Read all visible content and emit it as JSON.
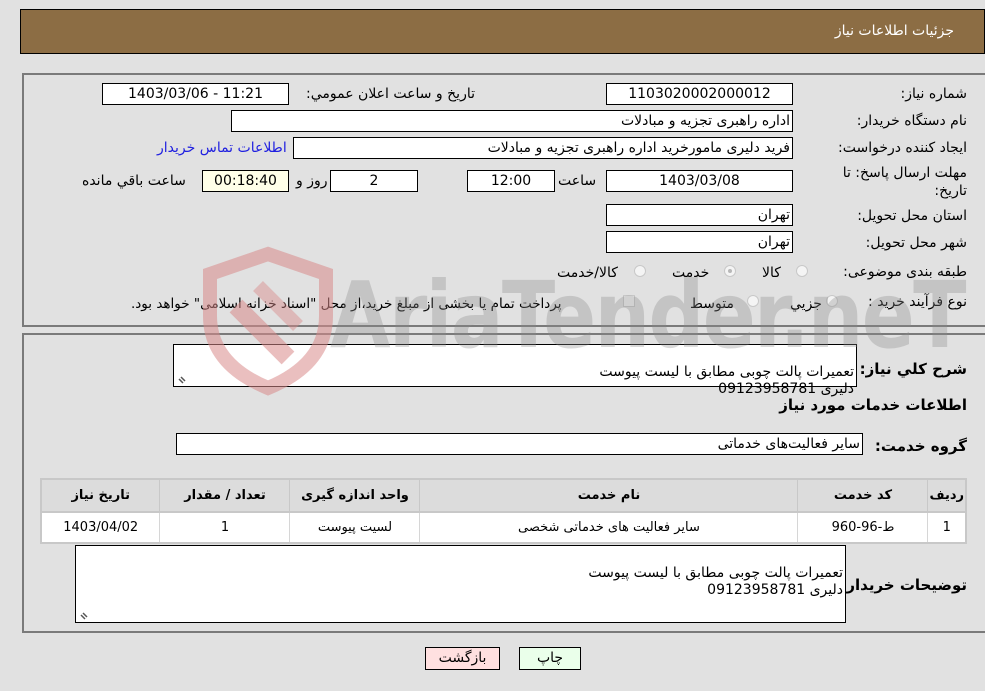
{
  "header": {
    "title": "جزئیات اطلاعات نیاز"
  },
  "form": {
    "need_number_label": "شماره نیاز:",
    "need_number": "1103020002000012",
    "announce_label": "تاریخ و ساعت اعلان عمومي:",
    "announce_value": "1403/03/06 - 11:21",
    "buyer_org_label": "نام دستگاه خريدار:",
    "buyer_org": "اداره راهبری تجزیه و مبادلات",
    "creator_label": "ایجاد کننده درخواست:",
    "creator": "فرید دلیری مامورخرید اداره راهبری تجزیه و مبادلات",
    "contact_link": "اطلاعات تماس خريدار",
    "deadline_label_1": "مهلت ارسال پاسخ: تا",
    "deadline_label_2": "تاريخ:",
    "deadline_date": "1403/03/08",
    "time_label": "ساعت",
    "deadline_time": "12:00",
    "days_value": "2",
    "days_label": "روز و",
    "remaining_time": "00:18:40",
    "remaining_label": "ساعت باقي مانده",
    "province_label": "استان محل تحویل:",
    "province": "تهران",
    "city_label": "شهر محل تحویل:",
    "city": "تهران",
    "category_label": "طبقه بندی موضوعی:",
    "category_options": [
      {
        "label": "کالا",
        "checked": false
      },
      {
        "label": "خدمت",
        "checked": true
      },
      {
        "label": "کالا/خدمت",
        "checked": false
      }
    ],
    "process_label": "نوع فرآیند خرید :",
    "process_options": [
      {
        "label": "جزيي",
        "checked": false
      },
      {
        "label": "متوسط",
        "checked": false
      }
    ],
    "treasury_checkbox_label": "پرداخت تمام یا بخشی از مبلغ خرید،از محل \"اسناد خزانه اسلامی\" خواهد بود.",
    "treasury_checked": false
  },
  "description": {
    "label": "شرح کلي نياز:",
    "value": "تعمیرات پالت چوبی مطابق با لیست پیوست\nدلیری 09123958781"
  },
  "services": {
    "section_title": "اطلاعات خدمات مورد نیاز",
    "group_label": "گروه خدمت:",
    "group_value": "سایر فعالیت‌های خدماتی",
    "columns": [
      "رديف",
      "کد خدمت",
      "نام خدمت",
      "واحد اندازه گیری",
      "تعداد / مقدار",
      "تاريخ نياز"
    ],
    "rows": [
      {
        "row": "1",
        "code": "ط-96-960",
        "name": "سایر فعالیت های خدماتی شخصی",
        "unit": "لسیت پیوست",
        "qty": "1",
        "date": "1403/04/02"
      }
    ]
  },
  "buyer_notes": {
    "label": "توضیحات خریدار:",
    "value": "تعمیرات پالت چوبی مطابق با لیست پیوست\nدلیری 09123958781"
  },
  "buttons": {
    "print": "چاپ",
    "back": "بازگشت"
  },
  "watermark": {
    "text": "AriaTender.neT"
  },
  "colors": {
    "header_bg": "#8c6d44",
    "print_bg": "#eaffea",
    "back_bg": "#ffe0e0",
    "link": "#2020e0"
  }
}
